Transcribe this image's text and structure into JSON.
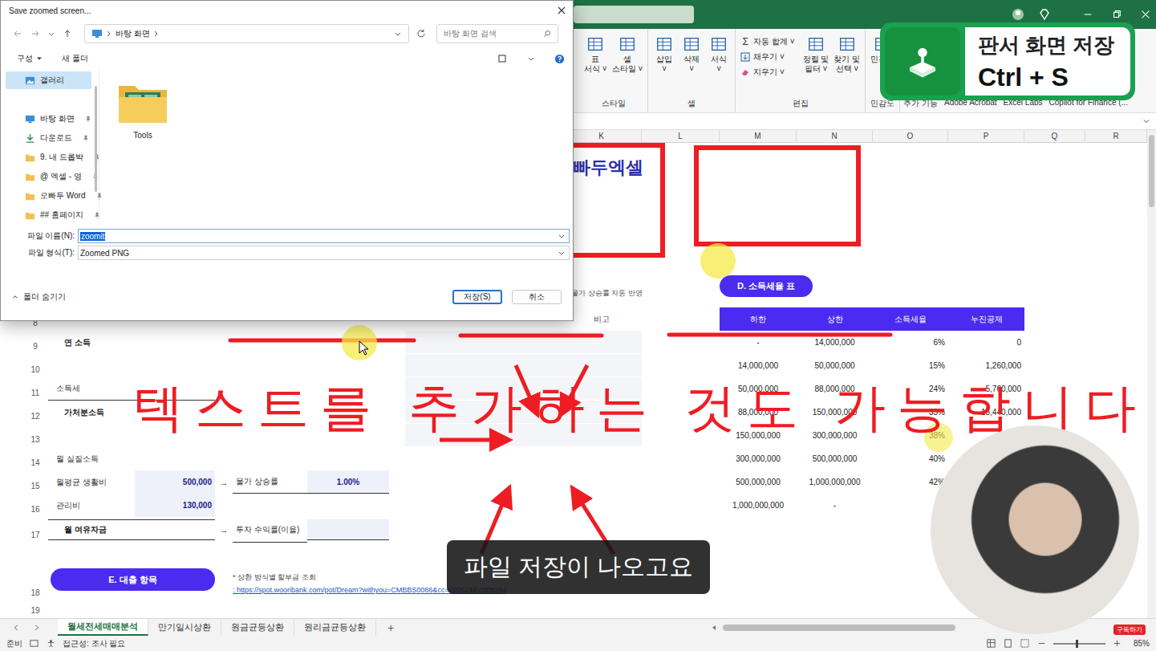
{
  "excel": {
    "ribbon": {
      "groups": [
        {
          "label": "스타일",
          "kind": "large",
          "buttons": [
            {
              "lines": [
                "표",
                "서식 ˅"
              ]
            },
            {
              "lines": [
                "셀",
                "스타일 ˅"
              ]
            }
          ]
        },
        {
          "label": "셀",
          "kind": "large",
          "buttons": [
            {
              "lines": [
                "삽입",
                "˅"
              ]
            },
            {
              "lines": [
                "삭제",
                "˅"
              ]
            },
            {
              "lines": [
                "서식",
                "˅"
              ]
            }
          ]
        },
        {
          "label": "편집",
          "kind": "edit",
          "small": [
            {
              "kind": "sum",
              "glyph": "Σ",
              "text": "자동 합계 ˅"
            },
            {
              "kind": "fill",
              "text": "채우기 ˅"
            },
            {
              "kind": "clear",
              "text": "지우기 ˅"
            }
          ],
          "buttons": [
            {
              "lines": [
                "정렬 및",
                "필터 ˅"
              ]
            },
            {
              "lines": [
                "찾기 및",
                "선택 ˅"
              ]
            }
          ]
        },
        {
          "label": "민감도",
          "kind": "large",
          "buttons": [
            {
              "lines": [
                "민감도"
              ]
            }
          ]
        },
        {
          "label": "추가 기능",
          "kind": "label",
          "buttons": []
        },
        {
          "label": "Adobe Acrobat",
          "kind": "label",
          "buttons": []
        },
        {
          "label": "Excel Labs",
          "kind": "label",
          "buttons": []
        },
        {
          "label": "Copilot for Finance (...",
          "kind": "label",
          "buttons": []
        }
      ]
    },
    "columns": [
      "K",
      "L",
      "M",
      "N",
      "O",
      "P",
      "Q",
      "R"
    ],
    "banner": {
      "logo": "빠두엑셀",
      "note": "물가 상승률 자동 반영",
      "section": "D. 소득세율 표"
    },
    "rows": [
      {
        "num": "8",
        "kind": "normal",
        "cells": [
          {
            "col": "c2",
            "kind": "colhead",
            "text": "비고"
          },
          {
            "col": "m",
            "kind": "taxhead",
            "text": "하한"
          },
          {
            "col": "n",
            "kind": "taxhead",
            "text": "상한"
          },
          {
            "col": "o",
            "kind": "taxhead",
            "text": "소득세율"
          },
          {
            "col": "p",
            "kind": "taxhead",
            "text": "누진공제"
          }
        ]
      },
      {
        "num": "9",
        "kind": "normal",
        "cells": [
          {
            "col": "aL",
            "span": 2,
            "kind": "heading",
            "text": "연 소득"
          },
          {
            "col": "c1",
            "span": 2,
            "kind": "memo",
            "text": ""
          },
          {
            "col": "m",
            "kind": "tax",
            "text": "-"
          },
          {
            "col": "n",
            "kind": "tax",
            "text": "14,000,000"
          },
          {
            "col": "o",
            "kind": "taxr",
            "text": "6%"
          },
          {
            "col": "p",
            "kind": "taxr",
            "text": "0"
          }
        ]
      },
      {
        "num": "10",
        "kind": "normal",
        "cells": [
          {
            "col": "c1",
            "span": 2,
            "kind": "memo",
            "text": ""
          },
          {
            "col": "m",
            "kind": "tax",
            "text": "14,000,000"
          },
          {
            "col": "n",
            "kind": "tax",
            "text": "50,000,000"
          },
          {
            "col": "o",
            "kind": "taxr",
            "text": "15%"
          },
          {
            "col": "p",
            "kind": "taxr",
            "text": "1,260,000"
          }
        ]
      },
      {
        "num": "11",
        "kind": "normal",
        "cells": [
          {
            "col": "aL",
            "span": 2,
            "kind": "labelline",
            "text": "소득세"
          },
          {
            "col": "c1",
            "span": 2,
            "kind": "memo",
            "text": ""
          },
          {
            "col": "m",
            "kind": "tax",
            "text": "50,000,000"
          },
          {
            "col": "n",
            "kind": "tax",
            "text": "88,000,000"
          },
          {
            "col": "o",
            "kind": "taxr",
            "text": "24%"
          },
          {
            "col": "p",
            "kind": "taxr",
            "text": "5,760,000"
          }
        ]
      },
      {
        "num": "12",
        "kind": "normal",
        "cells": [
          {
            "col": "aL",
            "span": 2,
            "kind": "heading",
            "text": "가처분소득"
          },
          {
            "col": "c1",
            "span": 2,
            "kind": "memo",
            "text": ""
          },
          {
            "col": "m",
            "kind": "tax",
            "text": "88,000,000"
          },
          {
            "col": "n",
            "kind": "tax",
            "text": "150,000,000"
          },
          {
            "col": "o",
            "kind": "taxr",
            "text": "35%"
          },
          {
            "col": "p",
            "kind": "taxr",
            "text": "15,440,000"
          }
        ]
      },
      {
        "num": "13",
        "kind": "normal",
        "cells": [
          {
            "col": "c1",
            "span": 2,
            "kind": "memo",
            "text": ""
          },
          {
            "col": "m",
            "kind": "tax",
            "text": "150,000,000"
          },
          {
            "col": "n",
            "kind": "tax",
            "text": "300,000,000"
          },
          {
            "col": "o",
            "kind": "taxr",
            "text": "38%"
          }
        ]
      },
      {
        "num": "14",
        "kind": "normal",
        "cells": [
          {
            "col": "aL",
            "span": 2,
            "kind": "label",
            "text": "월 실질소득"
          },
          {
            "col": "m",
            "kind": "tax",
            "text": "300,000,000"
          },
          {
            "col": "n",
            "kind": "tax",
            "text": "500,000,000"
          },
          {
            "col": "o",
            "kind": "taxr",
            "text": "40%"
          }
        ]
      },
      {
        "num": "15",
        "kind": "normal",
        "cells": [
          {
            "col": "aL",
            "kind": "label",
            "text": "월평균 생활비"
          },
          {
            "col": "aV",
            "kind": "amount",
            "text": "500,000"
          },
          {
            "col": "arr",
            "kind": "arrow",
            "text": "→"
          },
          {
            "col": "bL",
            "kind": "field",
            "text": "물가 상승률"
          },
          {
            "col": "bV",
            "kind": "amountc",
            "text": "1.00%"
          },
          {
            "col": "m",
            "kind": "tax",
            "text": "500,000,000"
          },
          {
            "col": "n",
            "kind": "tax",
            "text": "1,000,000,000"
          },
          {
            "col": "o",
            "kind": "taxr",
            "text": "42%"
          }
        ]
      },
      {
        "num": "16",
        "kind": "normal",
        "cells": [
          {
            "col": "aL",
            "kind": "label",
            "text": "관리비"
          },
          {
            "col": "aV",
            "kind": "amount",
            "text": "130,000"
          },
          {
            "col": "m",
            "kind": "tax",
            "text": "1,000,000,000"
          },
          {
            "col": "n",
            "kind": "tax",
            "text": "-"
          }
        ]
      },
      {
        "num": "17",
        "kind": "box",
        "cells": [
          {
            "col": "aL",
            "span": 2,
            "kind": "headingbox",
            "text": "월 여유자금"
          },
          {
            "col": "arr",
            "kind": "arrow",
            "text": "→"
          },
          {
            "col": "bL",
            "kind": "field",
            "text": "투자 수익률(이율)"
          },
          {
            "col": "bV",
            "kind": "amountfield",
            "text": ""
          }
        ]
      },
      {
        "num": "18",
        "kind": "section",
        "cells": [
          {
            "col": "aL",
            "span": 2,
            "kind": "pill",
            "text": "E. 대출 항목"
          },
          {
            "col": "bL",
            "span": 5,
            "kind": "note",
            "text": "* 상환 방식별 할부금 조회",
            "link": ": https://spot.wooribank.com/pot/Dream?withyou=CMBBS0086&cc=c006244:c008294"
          }
        ]
      },
      {
        "num": "19",
        "kind": "spacer",
        "cells": []
      }
    ],
    "sheet_tabs": [
      {
        "label": "월세전세매매분석",
        "selected": true
      },
      {
        "label": "만기일시상환",
        "selected": false
      },
      {
        "label": "원금균등상환",
        "selected": false
      },
      {
        "label": "원리금균등상환",
        "selected": false
      }
    ],
    "add_sheet": "+",
    "status_bar": {
      "ready": "준비",
      "accessibility": "접근성: 조사 필요",
      "zoom": "85%",
      "zoom_level": 0.45
    }
  },
  "dialog": {
    "title": "Save zoomed screen...",
    "path": [
      "바탕 화면"
    ],
    "search_placeholder": "바탕 화면 검색",
    "toolbar": {
      "organize": "구성",
      "new_folder": "새 폴더"
    },
    "sidebar": [
      {
        "label": "갤러리",
        "icon": "gallery",
        "selected": true,
        "pinned": false
      },
      {
        "label": "바탕 화면",
        "icon": "desktop",
        "selected": false,
        "pinned": true
      },
      {
        "label": "다운로드",
        "icon": "download",
        "selected": false,
        "pinned": true
      },
      {
        "label": "9. 내 드롭박",
        "icon": "folder",
        "selected": false,
        "pinned": true
      },
      {
        "label": "@ 엑셀 - 영",
        "icon": "folder",
        "selected": false,
        "pinned": true
      },
      {
        "label": "오빠두 Word",
        "icon": "folder",
        "selected": false,
        "pinned": true
      },
      {
        "label": "## 홈페이지",
        "icon": "folder",
        "selected": false,
        "pinned": true
      }
    ],
    "files": [
      {
        "name": "Tools"
      }
    ],
    "filename": {
      "label": "파일 이름(N):",
      "value": "zoomit",
      "selected": true
    },
    "filetype": {
      "label": "파일 형식(T):",
      "value": "Zoomed PNG"
    },
    "hide_folders": "폴더 숨기기",
    "buttons": [
      {
        "label": "저장(S)",
        "default": true
      },
      {
        "label": "취소",
        "default": false
      }
    ]
  },
  "annotation": {
    "text": "텍스트를 추가하는 것도 가능합니다"
  },
  "shortcut_badge": {
    "title": "판서 화면 저장",
    "keys": "Ctrl + S"
  },
  "subtitle": "파일 저장이 나오고요",
  "webcam": {
    "badge": "구독하기"
  }
}
